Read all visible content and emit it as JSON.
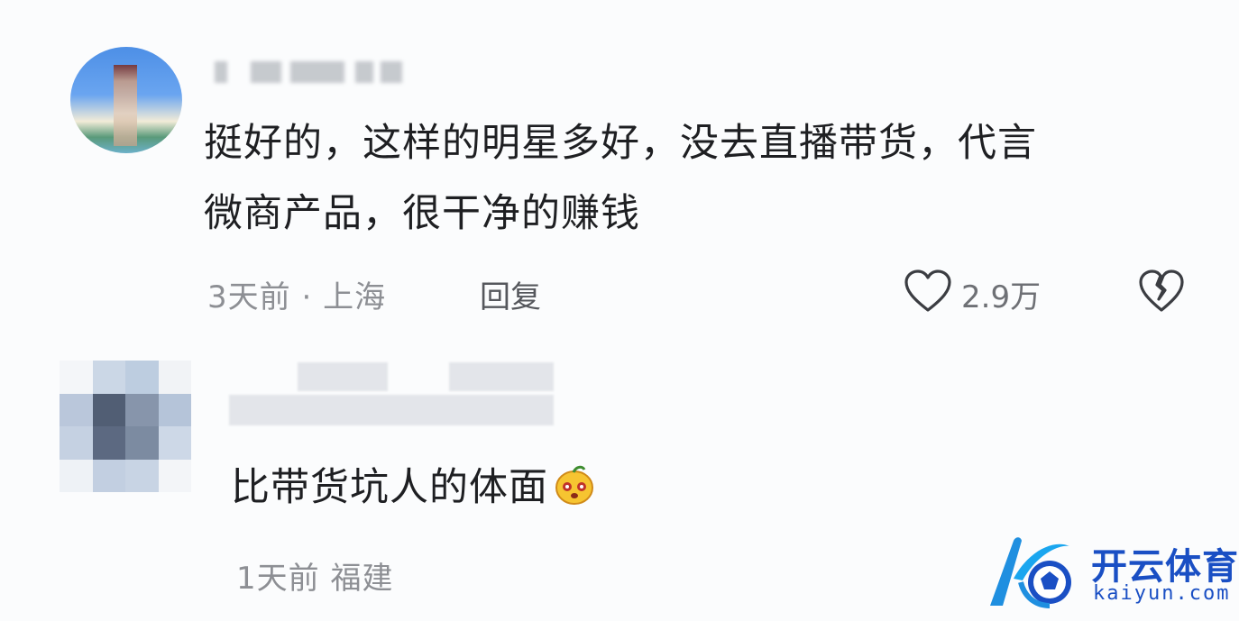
{
  "comments": [
    {
      "text_line1": "挺好的，这样的明星多好，没去直播带货，代言",
      "text_line2": "微商产品，很干净的赚钱",
      "time": "3天前",
      "separator": "·",
      "location": "上海",
      "reply_label": "回复",
      "like_count": "2.9万"
    },
    {
      "text": "比带货坑人的体面",
      "time": "1天前",
      "location": "福建"
    }
  ],
  "icons": {
    "like": "heart-outline-icon",
    "dislike": "broken-heart-icon",
    "emoji": "yellow-face-emoji"
  },
  "watermark": {
    "cn": "开云体育",
    "en": "kaiyun.com"
  },
  "colors": {
    "background": "#fbfcfd",
    "text": "#1e1f22",
    "meta": "#8d8f94",
    "watermark": "#1a4fc4"
  }
}
